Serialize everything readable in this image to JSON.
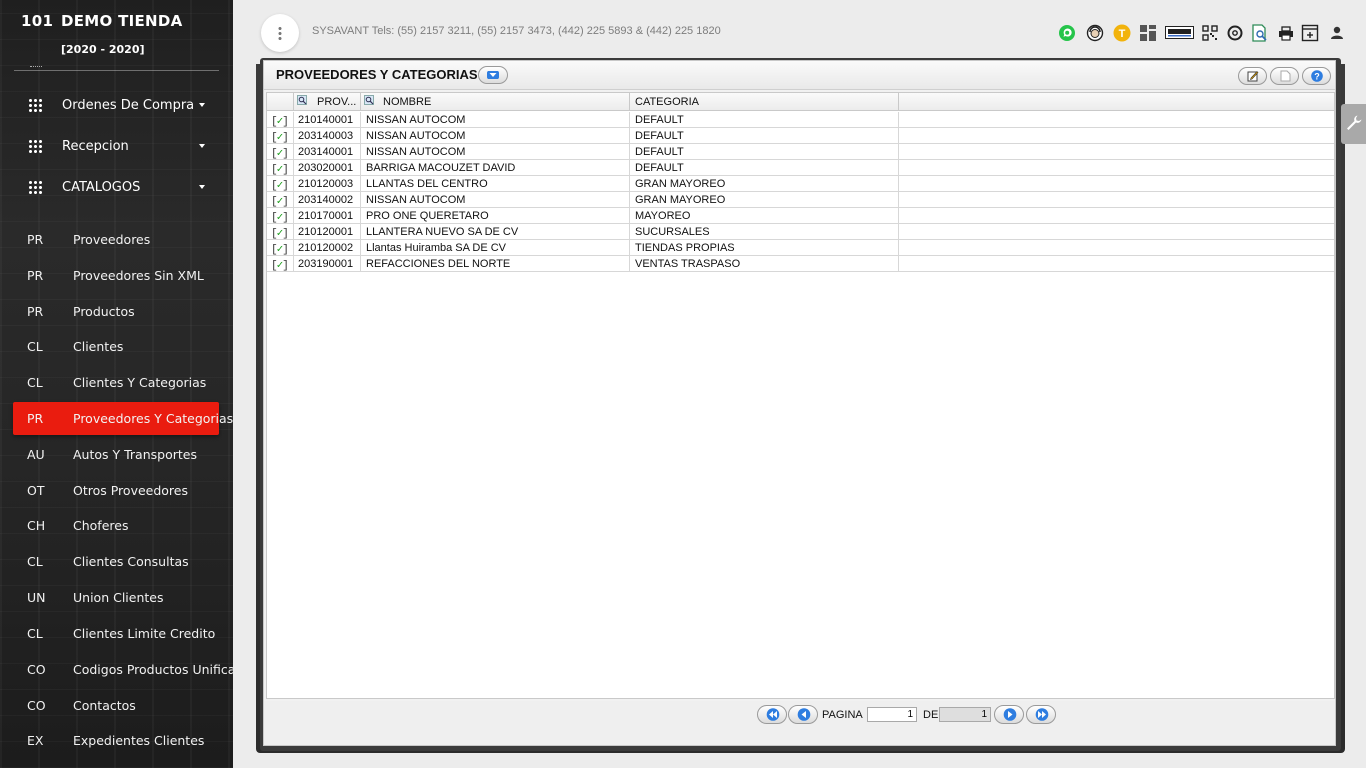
{
  "brand": {
    "number": "101",
    "name": "DEMO TIENDA",
    "years": "[2020 - 2020]"
  },
  "sidebar": {
    "groups": [
      {
        "label": "Ordenes De Compra"
      },
      {
        "label": "Recepcion"
      },
      {
        "label": "CATALOGOS"
      }
    ],
    "items": [
      {
        "abbr": "PR",
        "label": "Proveedores"
      },
      {
        "abbr": "PR",
        "label": "Proveedores Sin XML"
      },
      {
        "abbr": "PR",
        "label": "Productos"
      },
      {
        "abbr": "CL",
        "label": "Clientes"
      },
      {
        "abbr": "CL",
        "label": "Clientes Y Categorias"
      },
      {
        "abbr": "PR",
        "label": "Proveedores Y Categorias"
      },
      {
        "abbr": "AU",
        "label": "Autos Y Transportes"
      },
      {
        "abbr": "OT",
        "label": "Otros Proveedores"
      },
      {
        "abbr": "CH",
        "label": "Choferes"
      },
      {
        "abbr": "CL",
        "label": "Clientes Consultas"
      },
      {
        "abbr": "UN",
        "label": "Union Clientes"
      },
      {
        "abbr": "CL",
        "label": "Clientes Limite Credito"
      },
      {
        "abbr": "CO",
        "label": "Codigos Productos Unificados"
      },
      {
        "abbr": "CO",
        "label": "Contactos"
      },
      {
        "abbr": "EX",
        "label": "Expedientes Clientes"
      }
    ],
    "active_item": "Proveedores Y Categorias",
    "active_color": "#ea1c0f"
  },
  "topbar": {
    "contact": "SYSAVANT Tels: (55) 2157 3211, (55) 2157 3473, (442) 225 5893 & (442) 225 1820",
    "icons": [
      "whatsapp-icon",
      "support-agent-icon",
      "user-t-icon",
      "dashboard-icon",
      "xml-icon",
      "qr-code-icon",
      "tire-icon",
      "search-document-icon",
      "print-icon",
      "add-window-icon",
      "user-icon"
    ]
  },
  "panel": {
    "title": "PROVEEDORES Y CATEGORIAS",
    "columns": [
      "PROV...",
      "NOMBRE",
      "CATEGORIA"
    ],
    "rows": [
      {
        "check": "[✓]",
        "prov": "210140001",
        "nombre": "NISSAN AUTOCOM",
        "categoria": "DEFAULT"
      },
      {
        "check": "[✓]",
        "prov": "203140003",
        "nombre": "NISSAN AUTOCOM",
        "categoria": "DEFAULT"
      },
      {
        "check": "[✓]",
        "prov": "203140001",
        "nombre": "NISSAN AUTOCOM",
        "categoria": "DEFAULT"
      },
      {
        "check": "[✓]",
        "prov": "203020001",
        "nombre": "BARRIGA MACOUZET DAVID",
        "categoria": "DEFAULT"
      },
      {
        "check": "[✓]",
        "prov": "210120003",
        "nombre": "LLANTAS DEL CENTRO",
        "categoria": "GRAN MAYOREO"
      },
      {
        "check": "[✓]",
        "prov": "203140002",
        "nombre": "NISSAN AUTOCOM",
        "categoria": "GRAN MAYOREO"
      },
      {
        "check": "[✓]",
        "prov": "210170001",
        "nombre": "PRO ONE QUERETARO",
        "categoria": "MAYOREO"
      },
      {
        "check": "[✓]",
        "prov": "210120001",
        "nombre": "LLANTERA NUEVO SA DE CV",
        "categoria": "SUCURSALES"
      },
      {
        "check": "[✓]",
        "prov": "210120002",
        "nombre": "Llantas Huiramba SA DE CV",
        "categoria": "TIENDAS PROPIAS"
      },
      {
        "check": "[✓]",
        "prov": "203190001",
        "nombre": "REFACCIONES DEL NORTE",
        "categoria": "VENTAS TRASPASO"
      }
    ]
  },
  "pager": {
    "label_page": "PAGINA",
    "page": "1",
    "label_of": "DE",
    "total": "1"
  }
}
